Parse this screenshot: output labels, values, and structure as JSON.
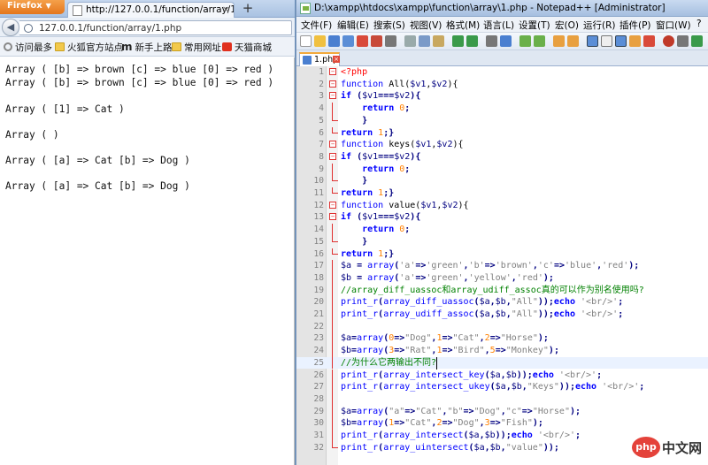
{
  "firefox": {
    "menu_label": "Firefox",
    "tab_title": "http://127.0.0.1/function/array/1.php",
    "url": "127.0.0.1/function/array/1.php",
    "bookmarks": [
      {
        "label": "访问最多",
        "icon": "gear-icon"
      },
      {
        "label": "火狐官方站点",
        "icon": "folder-icon"
      },
      {
        "label": "新手上路",
        "icon": "m-icon"
      },
      {
        "label": "常用网址",
        "icon": "folder-icon"
      },
      {
        "label": "天猫商城",
        "icon": "tmall-icon"
      }
    ],
    "output_lines": [
      "Array ( [b] => brown [c] => blue [0] => red )",
      "Array ( [b] => brown [c] => blue [0] => red )",
      "Array ( [1] => Cat )",
      "Array ( )",
      "Array ( [a] => Cat [b] => Dog )",
      "Array ( [a] => Cat [b] => Dog )"
    ]
  },
  "notepad": {
    "title": "D:\\xampp\\htdocs\\xampp\\function\\array\\1.php - Notepad++ [Administrator]",
    "menu": [
      "文件(F)",
      "编辑(E)",
      "搜索(S)",
      "视图(V)",
      "格式(M)",
      "语言(L)",
      "设置(T)",
      "宏(O)",
      "运行(R)",
      "插件(P)",
      "窗口(W)",
      "?"
    ],
    "tab_label": "1.php",
    "line_numbers": [
      "1",
      "2",
      "3",
      "4",
      "5",
      "6",
      "7",
      "8",
      "9",
      "10",
      "11",
      "12",
      "13",
      "14",
      "15",
      "16",
      "17",
      "18",
      "19",
      "20",
      "21",
      "22",
      "23",
      "24",
      "25",
      "26",
      "27",
      "28",
      "29",
      "30",
      "31",
      "32"
    ]
  },
  "watermark": {
    "logo": "php",
    "text": "中文网"
  },
  "colors": {
    "keyword": "#0000ff",
    "number": "#ff8000",
    "string": "#808080",
    "comment": "#008000",
    "fold_marker": "#e03030"
  }
}
